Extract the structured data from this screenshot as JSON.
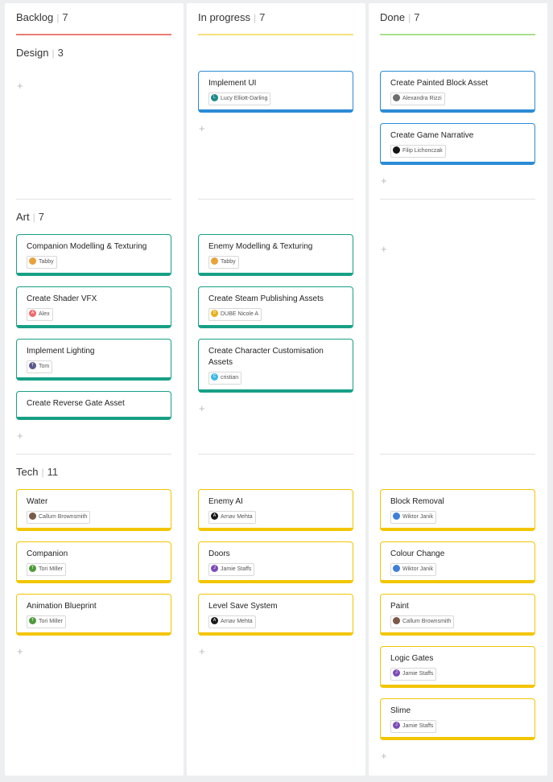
{
  "columns": [
    {
      "title": "Backlog",
      "count": "7",
      "bar_color": "#ea7d74"
    },
    {
      "title": "In progress",
      "count": "7",
      "bar_color": "#f4e27a"
    },
    {
      "title": "Done",
      "count": "7",
      "bar_color": "#a8e08c"
    }
  ],
  "groups": {
    "design": {
      "title": "Design",
      "count": "3"
    },
    "art": {
      "title": "Art",
      "count": "7"
    },
    "tech": {
      "title": "Tech",
      "count": "11"
    }
  },
  "add_symbol": "+",
  "separator": "|",
  "cards": {
    "backlog": {
      "art": [
        {
          "title": "Companion Modelling & Texturing",
          "assignee": "Tabby",
          "avatar": "A",
          "avatar_color": "#e8a23b"
        },
        {
          "title": "Create Shader VFX",
          "assignee": "Alex",
          "avatar": "A",
          "avatar_color": "#f06a6a"
        },
        {
          "title": "Implement Lighting",
          "assignee": "Tom",
          "avatar": "T",
          "avatar_color": "#5b5b8f"
        },
        {
          "title": "Create Reverse Gate Asset"
        }
      ],
      "tech": [
        {
          "title": "Water",
          "assignee": "Callum Brownsmith",
          "avatar": "C",
          "avatar_color": "#7a5a48"
        },
        {
          "title": "Companion",
          "assignee": "Tori Miller",
          "avatar": "T",
          "avatar_color": "#4f9a3b"
        },
        {
          "title": "Animation Blueprint",
          "assignee": "Tori Miller",
          "avatar": "T",
          "avatar_color": "#4f9a3b"
        }
      ]
    },
    "inprogress": {
      "design": [
        {
          "title": "Implement UI",
          "assignee": "Lucy Elliott-Darling",
          "avatar": "L",
          "avatar_color": "#1b8a8a"
        }
      ],
      "art": [
        {
          "title": "Enemy Modelling & Texturing",
          "assignee": "Tabby",
          "avatar": "A",
          "avatar_color": "#e8a23b"
        },
        {
          "title": "Create Steam Publishing Assets",
          "assignee": "DUBE Nicole A",
          "avatar": "D",
          "avatar_color": "#e8b018"
        },
        {
          "title": "Create Character Customisation Assets",
          "assignee": "cristian",
          "avatar": "C",
          "avatar_color": "#3fb8e6"
        }
      ],
      "tech": [
        {
          "title": "Enemy AI",
          "assignee": "Arnav Mehta",
          "avatar": "A",
          "avatar_color": "#1a1a1a"
        },
        {
          "title": "Doors",
          "assignee": "Jamie Staffs",
          "avatar": "J",
          "avatar_color": "#7d4bb8"
        },
        {
          "title": "Level Save System",
          "assignee": "Arnav Mehta",
          "avatar": "A",
          "avatar_color": "#1a1a1a"
        }
      ]
    },
    "done": {
      "design": [
        {
          "title": "Create Painted Block Asset",
          "assignee": "Alexandra Rizzi",
          "avatar": "A",
          "avatar_color": "#6d6d6d"
        },
        {
          "title": "Create Game Narrative",
          "assignee": "Filip Lichonczak",
          "avatar": "F",
          "avatar_color": "#151515"
        }
      ],
      "tech": [
        {
          "title": "Block Removal",
          "assignee": "Wiktor Janik",
          "avatar": "W",
          "avatar_color": "#3f7fd6"
        },
        {
          "title": "Colour Change",
          "assignee": "Wiktor Janik",
          "avatar": "W",
          "avatar_color": "#3f7fd6"
        },
        {
          "title": "Paint",
          "assignee": "Callum Brownsmith",
          "avatar": "C",
          "avatar_color": "#7a5a48"
        },
        {
          "title": "Logic Gates",
          "assignee": "Jamie Staffs",
          "avatar": "J",
          "avatar_color": "#7d4bb8"
        },
        {
          "title": "Slime",
          "assignee": "Jamie Staffs",
          "avatar": "J",
          "avatar_color": "#7d4bb8"
        }
      ]
    }
  }
}
